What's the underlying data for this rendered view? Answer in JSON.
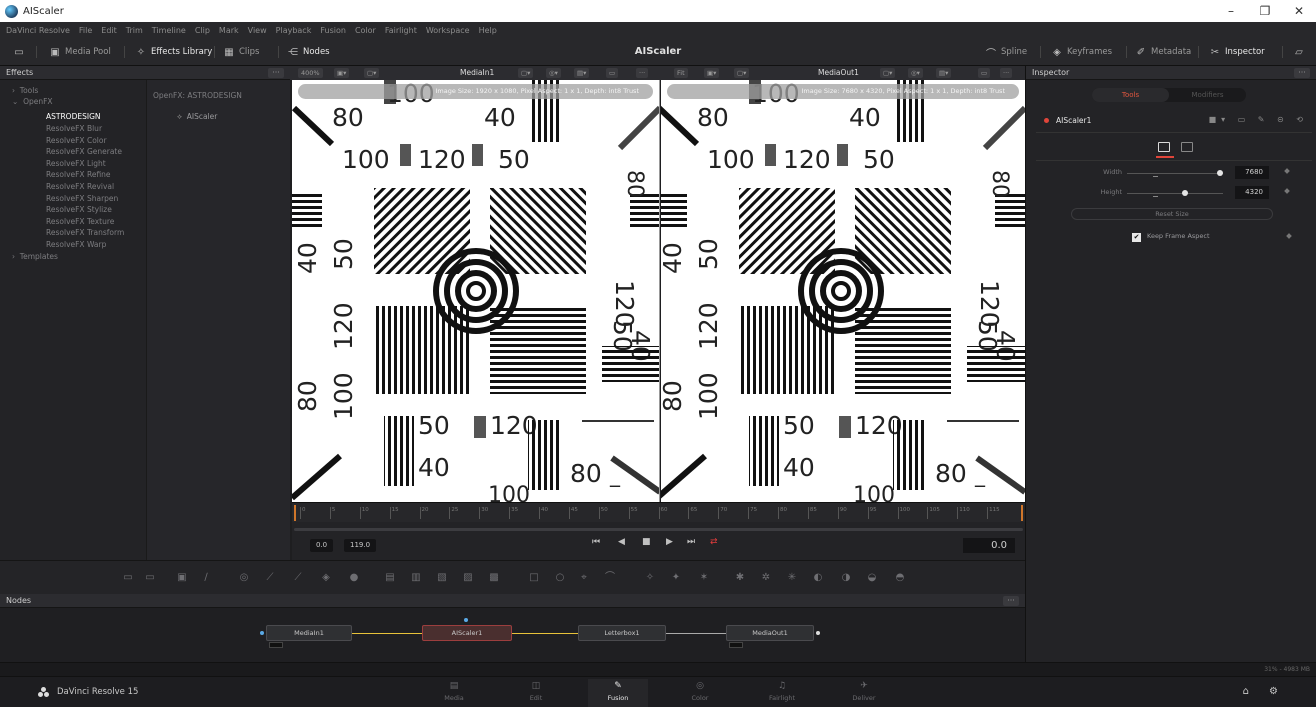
{
  "window": {
    "title": "AIScaler",
    "controls": [
      "–",
      "❐",
      "✕"
    ]
  },
  "menu": [
    "DaVinci Resolve",
    "File",
    "Edit",
    "Trim",
    "Timeline",
    "Clip",
    "Mark",
    "View",
    "Playback",
    "Fusion",
    "Color",
    "Fairlight",
    "Workspace",
    "Help"
  ],
  "toolbar": {
    "center_title": "AIScaler",
    "left": [
      {
        "label": "Media Pool",
        "icon": "media-pool-icon"
      },
      {
        "label": "Effects Library",
        "icon": "effects-library-icon"
      },
      {
        "label": "Clips",
        "icon": "clips-icon"
      },
      {
        "label": "Nodes",
        "icon": "nodes-icon"
      }
    ],
    "right": [
      {
        "label": "Spline",
        "icon": "spline-icon"
      },
      {
        "label": "Keyframes",
        "icon": "keyframes-icon"
      },
      {
        "label": "Metadata",
        "icon": "metadata-icon"
      },
      {
        "label": "Inspector",
        "icon": "inspector-icon"
      }
    ]
  },
  "effects": {
    "header": "Effects",
    "tree": [
      "Tools",
      "OpenFX",
      "ASTRODESIGN",
      "ResolveFX Blur",
      "ResolveFX Color",
      "ResolveFX Generate",
      "ResolveFX Light",
      "ResolveFX Refine",
      "ResolveFX Revival",
      "ResolveFX Sharpen",
      "ResolveFX Stylize",
      "ResolveFX Texture",
      "ResolveFX Transform",
      "ResolveFX Warp",
      "Templates"
    ],
    "selected_index": 2,
    "category_title": "OpenFX: ASTRODESIGN",
    "plugin": "AIScaler"
  },
  "viewers": [
    {
      "name": "MediaIn1",
      "zoom": "400%",
      "info": "Image Size: 1920 x 1080, Pixel Aspect: 1 x 1, Depth: int8 Trust"
    },
    {
      "name": "MediaOut1",
      "zoom": "Fit",
      "info": "Image Size: 7680 x 4320, Pixel Aspect: 1 x 1, Depth: int8 Trust"
    }
  ],
  "chart_labels": {
    "n80": "80",
    "n100": "100",
    "n120": "120",
    "n40": "40",
    "n50": "50"
  },
  "ruler_ticks": [
    "0",
    "5",
    "10",
    "15",
    "20",
    "25",
    "30",
    "35",
    "40",
    "45",
    "50",
    "55",
    "60",
    "65",
    "70",
    "75",
    "80",
    "85",
    "90",
    "95",
    "100",
    "105",
    "110",
    "115"
  ],
  "transport": {
    "start": "0.0",
    "end": "119.0",
    "current": "0.0"
  },
  "nodes": {
    "header": "Nodes",
    "items": [
      "MediaIn1",
      "AIScaler1",
      "Letterbox1",
      "MediaOut1"
    ]
  },
  "inspector": {
    "header": "Inspector",
    "tabs": [
      "Tools",
      "Modifiers"
    ],
    "tool_name": "AIScaler1",
    "params": [
      {
        "label": "Width",
        "value": "7680"
      },
      {
        "label": "Height",
        "value": "4320"
      }
    ],
    "reset_label": "Reset Size",
    "checkbox_label": "Keep Frame Aspect"
  },
  "status": {
    "memory": "31% - 4983 MB"
  },
  "app": {
    "brand": "DaVinci Resolve 15"
  },
  "pages": [
    {
      "label": "Media",
      "icon": "media-page-icon",
      "glyph": "▤"
    },
    {
      "label": "Edit",
      "icon": "edit-page-icon",
      "glyph": "◫"
    },
    {
      "label": "Fusion",
      "icon": "fusion-page-icon",
      "glyph": "✎"
    },
    {
      "label": "Color",
      "icon": "color-page-icon",
      "glyph": "◎"
    },
    {
      "label": "Fairlight",
      "icon": "fairlight-page-icon",
      "glyph": "♫"
    },
    {
      "label": "Deliver",
      "icon": "deliver-page-icon",
      "glyph": "✈"
    }
  ],
  "active_page": "Fusion",
  "colors": {
    "accent_red": "#e0453a",
    "link_yellow": "#e8c23a",
    "ruler_orange": "#d0762a"
  }
}
